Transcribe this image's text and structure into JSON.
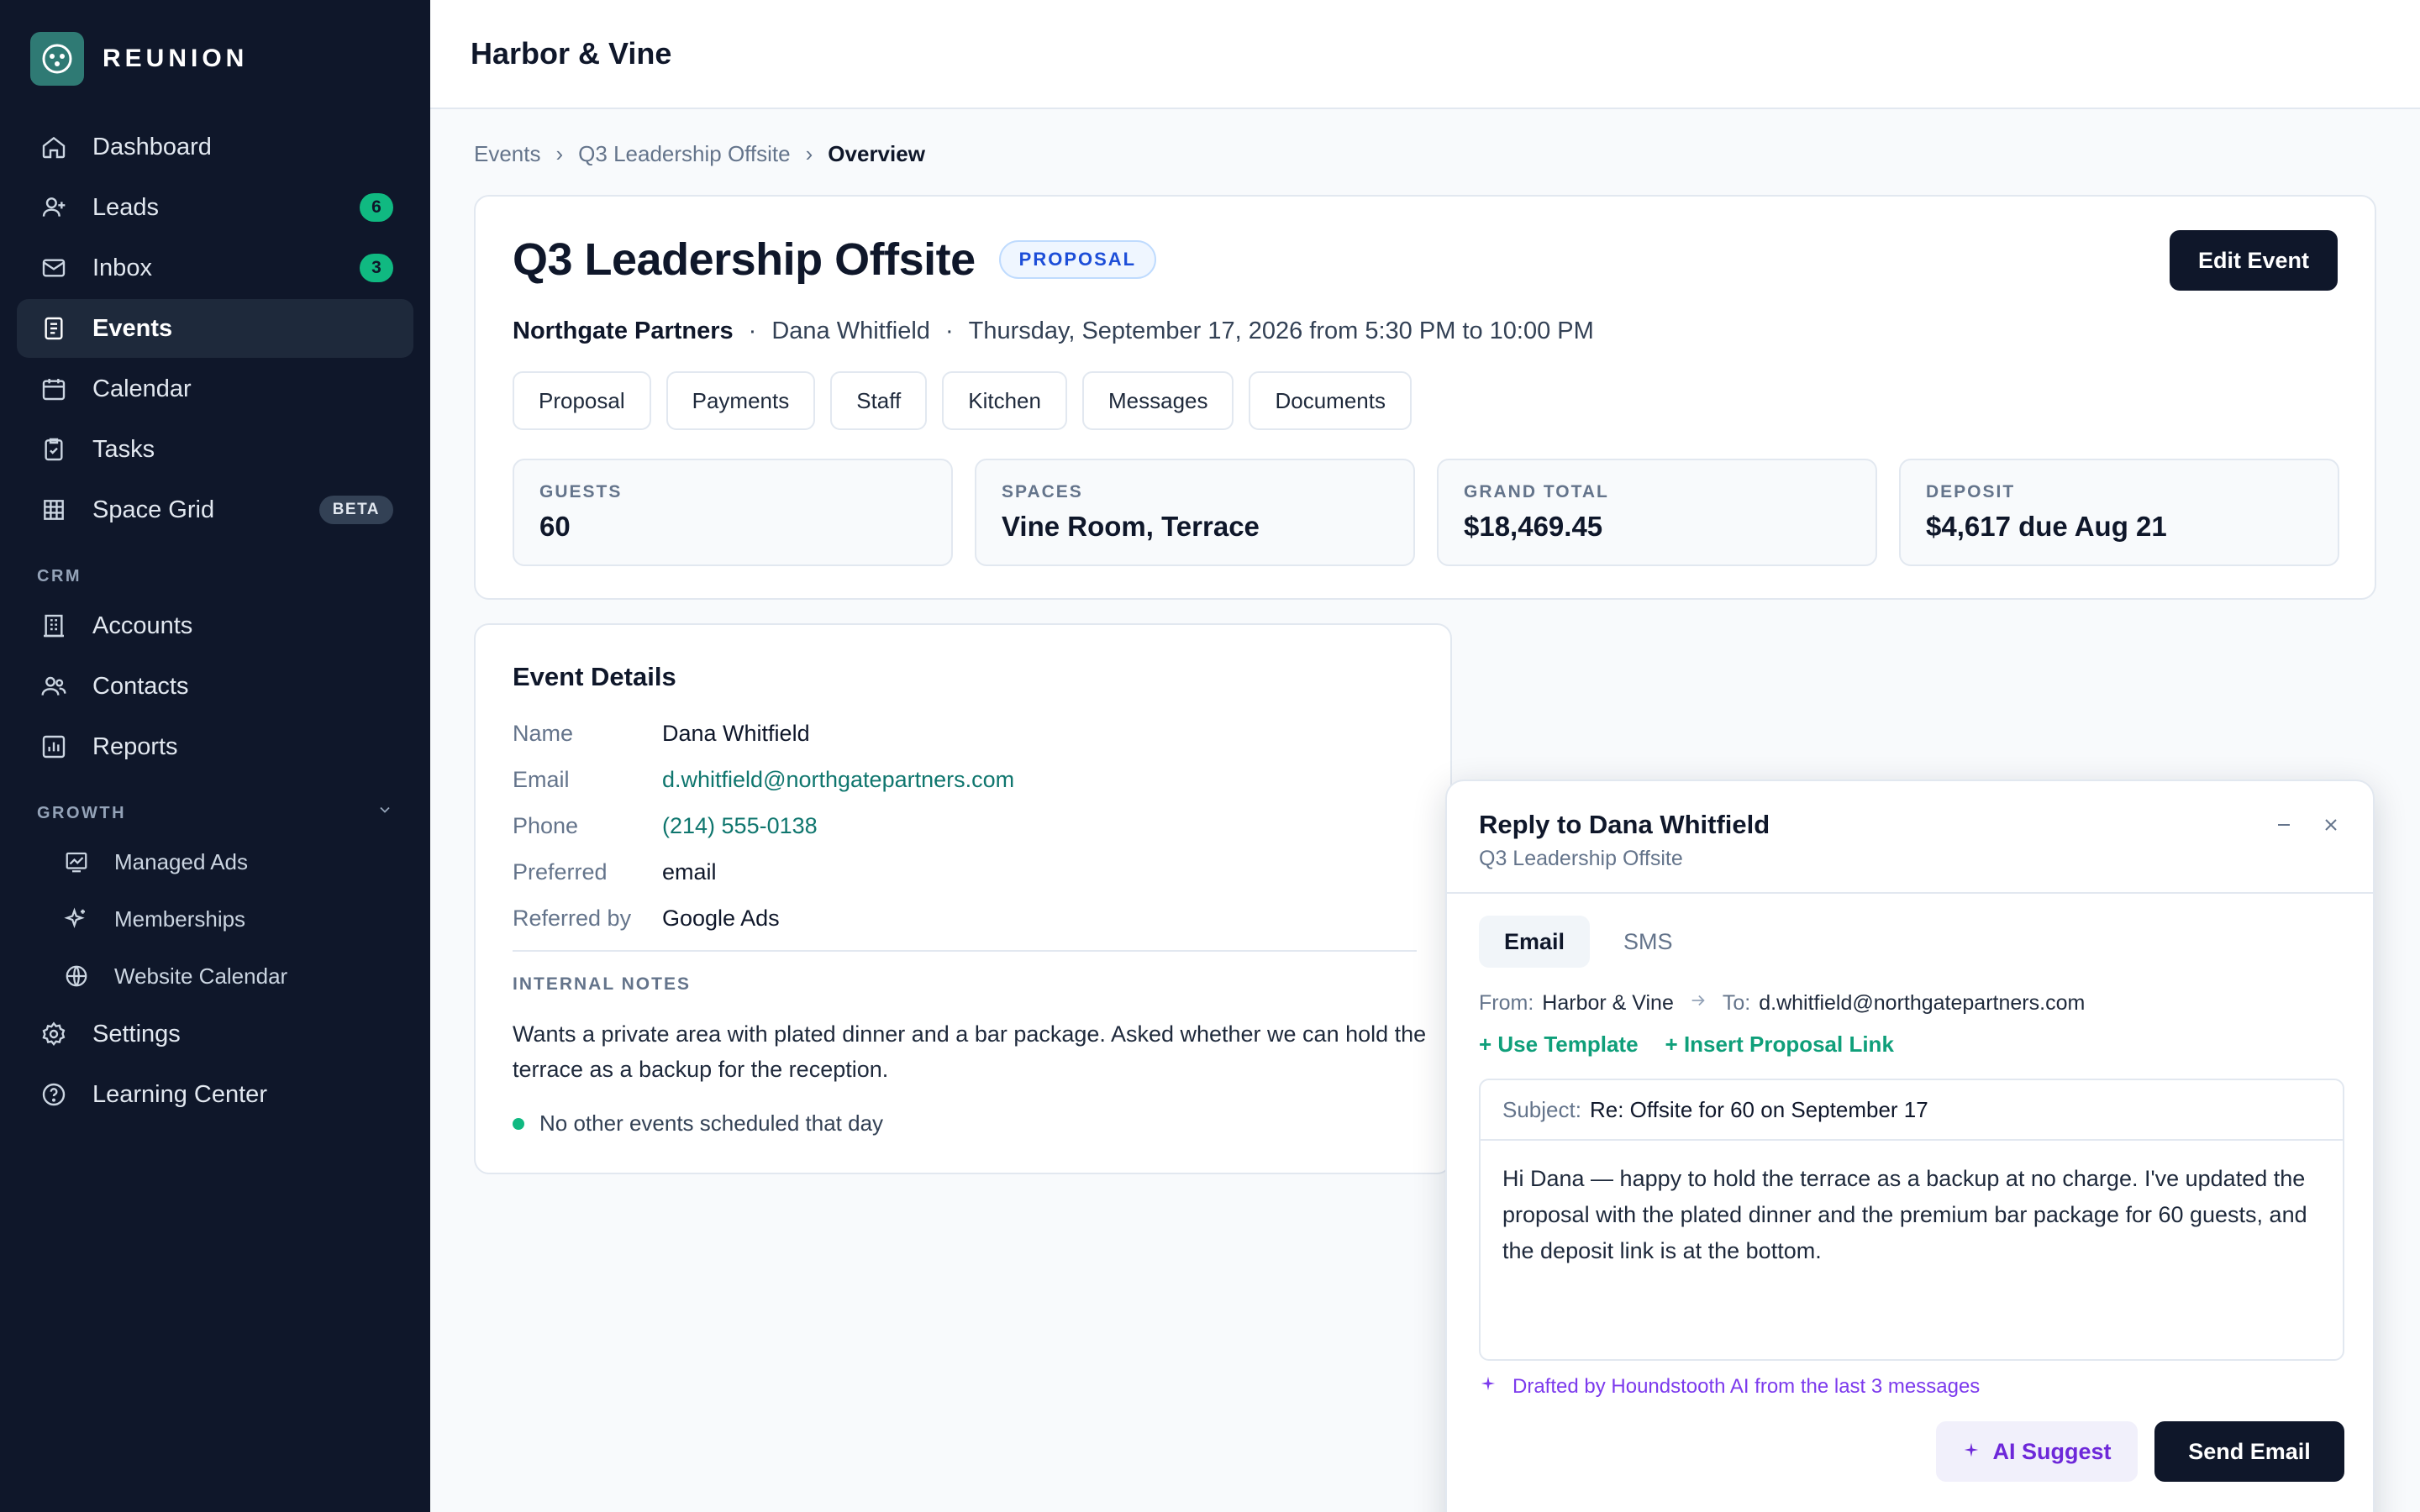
{
  "app": {
    "brand": "REUNION",
    "venue": "Harbor & Vine"
  },
  "sidebar": {
    "items": [
      {
        "label": "Dashboard",
        "icon": "home-icon"
      },
      {
        "label": "Leads",
        "icon": "user-plus-icon",
        "badge": "6"
      },
      {
        "label": "Inbox",
        "icon": "mail-icon",
        "badge": "3"
      },
      {
        "label": "Events",
        "icon": "document-icon",
        "active": true
      },
      {
        "label": "Calendar",
        "icon": "calendar-icon"
      },
      {
        "label": "Tasks",
        "icon": "clipboard-check-icon"
      },
      {
        "label": "Space Grid",
        "icon": "grid-icon",
        "tag": "BETA"
      }
    ],
    "crm_label": "CRM",
    "crm_items": [
      {
        "label": "Accounts",
        "icon": "building-icon"
      },
      {
        "label": "Contacts",
        "icon": "users-icon"
      },
      {
        "label": "Reports",
        "icon": "bar-chart-icon"
      }
    ],
    "growth_label": "GROWTH",
    "growth_items": [
      {
        "label": "Managed Ads",
        "icon": "trend-chart-icon"
      },
      {
        "label": "Memberships",
        "icon": "sparkles-icon"
      },
      {
        "label": "Website Calendar",
        "icon": "globe-icon"
      }
    ],
    "bottom_items": [
      {
        "label": "Settings",
        "icon": "gear-icon"
      },
      {
        "label": "Learning Center",
        "icon": "help-circle-icon"
      }
    ]
  },
  "breadcrumb": {
    "root": "Events",
    "parent": "Q3 Leadership Offsite",
    "current": "Overview",
    "sep": "›"
  },
  "event": {
    "title": "Q3 Leadership Offsite",
    "status": "PROPOSAL",
    "edit_label": "Edit Event",
    "company": "Northgate Partners",
    "contact": "Dana Whitfield",
    "when": "Thursday, September 17, 2026 from 5:30 PM to 10:00 PM",
    "dot": "·",
    "tabs": [
      "Proposal",
      "Payments",
      "Staff",
      "Kitchen",
      "Messages",
      "Documents"
    ],
    "stats": [
      {
        "label": "GUESTS",
        "value": "60"
      },
      {
        "label": "SPACES",
        "value": "Vine Room, Terrace"
      },
      {
        "label": "GRAND TOTAL",
        "value": "$18,469.45"
      },
      {
        "label": "DEPOSIT",
        "value": "$4,617 due Aug 21"
      }
    ]
  },
  "details": {
    "title": "Event Details",
    "rows": [
      {
        "label": "Name",
        "value": "Dana Whitfield"
      },
      {
        "label": "Email",
        "value": "d.whitfield@northgatepartners.com"
      },
      {
        "label": "Phone",
        "value": "(214) 555-0138"
      },
      {
        "label": "Preferred",
        "value": "email"
      },
      {
        "label": "Referred by",
        "value": "Google Ads"
      }
    ],
    "notes_label": "INTERNAL NOTES",
    "notes": "Wants a private area with plated dinner and a bar package. Asked whether we can hold the terrace as a backup for the reception.",
    "availability": "No other events scheduled that day"
  },
  "reply": {
    "title": "Reply to Dana Whitfield",
    "subtitle": "Q3 Leadership Offsite",
    "tabs": [
      "Email",
      "SMS"
    ],
    "from_label": "From:",
    "from": "Harbor & Vine",
    "to_label": "To:",
    "to": "d.whitfield@northgatepartners.com",
    "use_template": "+ Use Template",
    "insert_link": "+ Insert Proposal Link",
    "subject_label": "Subject:",
    "subject": "Re: Offsite for 60 on September 17",
    "body": "Hi Dana — happy to hold the terrace as a backup at no charge. I've updated the proposal with the plated dinner and the premium bar package for 60 guests, and the deposit link is at the bottom.",
    "ai_note": "Drafted by Houndstooth AI from the last 3 messages",
    "ai_button": "AI Suggest",
    "send_button": "Send Email"
  },
  "colors": {
    "sidebar": "#0f172a",
    "accent": "#10b981",
    "link": "#0f766e",
    "ai": "#7c3aed",
    "status": "#1d4ed8"
  }
}
